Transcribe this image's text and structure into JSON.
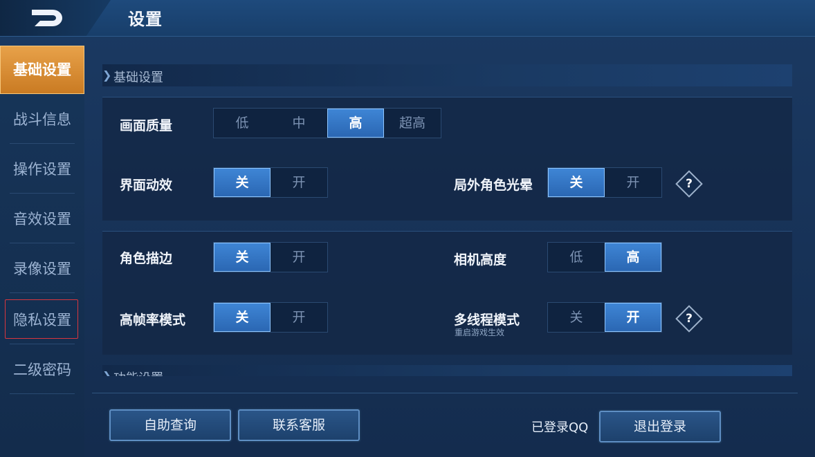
{
  "header": {
    "title": "设置",
    "back_icon": "back-arrow-icon"
  },
  "sidebar": {
    "items": [
      {
        "label": "基础设置"
      },
      {
        "label": "战斗信息"
      },
      {
        "label": "操作设置"
      },
      {
        "label": "音效设置"
      },
      {
        "label": "录像设置"
      },
      {
        "label": "隐私设置"
      },
      {
        "label": "二级密码"
      }
    ],
    "active_index": 0,
    "highlight_index": 5
  },
  "sections": {
    "basic": "基础设置",
    "feature": "功能设置"
  },
  "settings": {
    "quality": {
      "label": "画面质量",
      "options": [
        "低",
        "中",
        "高",
        "超高"
      ],
      "selected": "高"
    },
    "ui_effects": {
      "label": "界面动效",
      "options": [
        "关",
        "开"
      ],
      "selected": "关"
    },
    "outer_glow": {
      "label": "局外角色光晕",
      "options": [
        "关",
        "开"
      ],
      "selected": "关"
    },
    "outline": {
      "label": "角色描边",
      "options": [
        "关",
        "开"
      ],
      "selected": "关"
    },
    "camera": {
      "label": "相机高度",
      "options": [
        "低",
        "高"
      ],
      "selected": "高"
    },
    "high_fps": {
      "label": "高帧率模式",
      "options": [
        "关",
        "开"
      ],
      "selected": "关"
    },
    "multithread": {
      "label": "多线程模式",
      "sublabel": "重启游戏生效",
      "options": [
        "关",
        "开"
      ],
      "selected": "开"
    }
  },
  "help_glyph": "?",
  "footer": {
    "self_query": "自助查询",
    "contact": "联系客服",
    "login_status": "已登录QQ",
    "logout": "退出登录"
  },
  "colors": {
    "accent": "#e8a24a",
    "selected_blue": "#3f86d6"
  }
}
